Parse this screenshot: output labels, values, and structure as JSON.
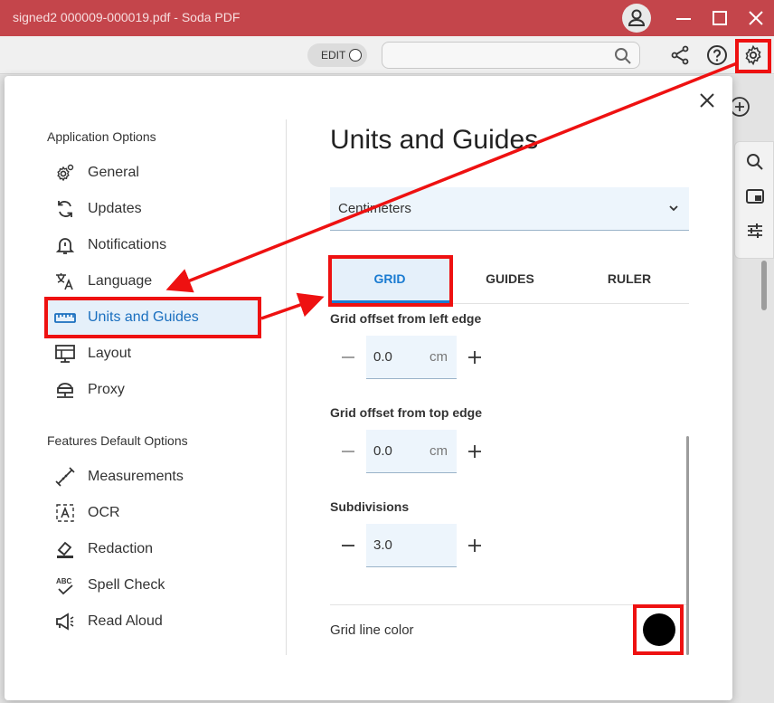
{
  "window": {
    "title": "signed2 000009-000019.pdf   -   Soda PDF",
    "accent": "#c4454b"
  },
  "toolbar": {
    "edit_label": "EDIT",
    "search_placeholder": ""
  },
  "dialog": {
    "close_icon": "close-icon",
    "sidebar": {
      "app_header": "Application Options",
      "app_items": [
        {
          "label": "General",
          "icon": "gear-icon"
        },
        {
          "label": "Updates",
          "icon": "refresh-icon"
        },
        {
          "label": "Notifications",
          "icon": "bell-icon"
        },
        {
          "label": "Language",
          "icon": "translate-icon"
        },
        {
          "label": "Units and Guides",
          "icon": "ruler-icon",
          "active": true
        },
        {
          "label": "Layout",
          "icon": "layout-icon"
        },
        {
          "label": "Proxy",
          "icon": "proxy-icon"
        }
      ],
      "features_header": "Features Default Options",
      "feature_items": [
        {
          "label": "Measurements",
          "icon": "measure-icon"
        },
        {
          "label": "OCR",
          "icon": "ocr-icon"
        },
        {
          "label": "Redaction",
          "icon": "eraser-icon"
        },
        {
          "label": "Spell Check",
          "icon": "spellcheck-icon"
        },
        {
          "label": "Read Aloud",
          "icon": "megaphone-icon"
        }
      ]
    },
    "panel": {
      "title": "Units and Guides",
      "unit_select": "Centimeters",
      "tabs": [
        "GRID",
        "GUIDES",
        "RULER"
      ],
      "active_tab": "GRID",
      "fields": [
        {
          "label": "Grid offset from left edge",
          "value": "0.0",
          "unit": "cm"
        },
        {
          "label": "Grid offset from top edge",
          "value": "0.0",
          "unit": "cm"
        },
        {
          "label": "Subdivisions",
          "value": "3.0",
          "unit": ""
        }
      ],
      "grid_color_label": "Grid line color",
      "grid_color": "#000000"
    }
  },
  "annotation_color": "#ee1111"
}
